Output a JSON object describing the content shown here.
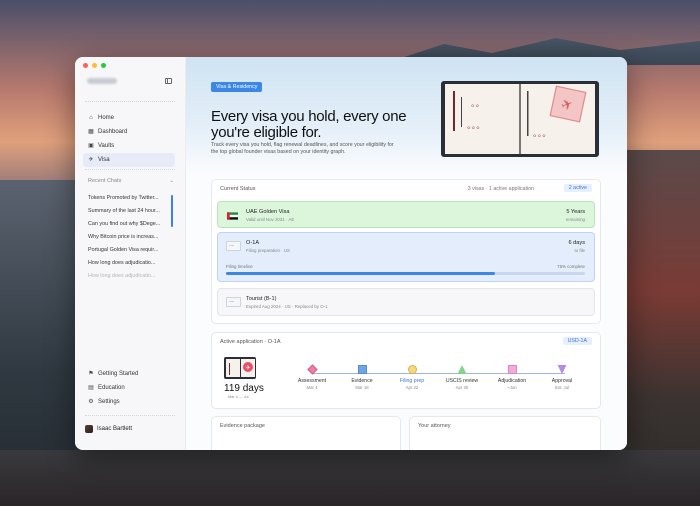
{
  "nav": {
    "home": "Home",
    "dashboard": "Dashboard",
    "vaults": "Vaults",
    "visa": "Visa"
  },
  "recent": {
    "heading": "Recent Chats",
    "items": [
      "Tokens Promoted by Twitter...",
      "Summary of the last 24 hour...",
      "Can you find out why $Dege...",
      "Why Bitcoin price is increas...",
      "Portugal Golden Visa requir...",
      "How long does adjudicatio...",
      "How long does adjudicatio..."
    ]
  },
  "bottom_nav": {
    "getting_started": "Getting Started",
    "education": "Education",
    "settings": "Settings"
  },
  "user": {
    "name": "Isaac Bartlett"
  },
  "hero": {
    "tag": "Visa & Residency",
    "title": "Every visa you hold, every one you're eligible for.",
    "subtitle": "Track every visa you hold, flag renewal deadlines, and score your eligibility for the top global founder visas based on your identity graph."
  },
  "current_status": {
    "heading": "Current Status",
    "summary": "3 visas · 1 active application",
    "badge": "2 active",
    "rows": [
      {
        "title": "UAE Golden Visa",
        "sub": "Valid until Nov 2031 · AE",
        "value": "5 Years",
        "value_sub": "remaining"
      },
      {
        "title": "O-1A",
        "sub": "Filing preparation · US",
        "value": "6 days",
        "value_sub": "to file",
        "progress_label": "Filing timeline",
        "progress_text": "75% complete",
        "progress": 0.75
      },
      {
        "title": "Tourist (B-1)",
        "sub": "Expired Aug 2024 · US · Replaced by O-1"
      }
    ]
  },
  "active_application": {
    "heading": "Active application · O-1A",
    "badge": "USD-1A",
    "days": "119 days",
    "days_sub": "Mar 4 → Jul",
    "steps": [
      {
        "label": "Assessment",
        "date": "Mar 4",
        "color": "#f07aa8",
        "shape": "diamond"
      },
      {
        "label": "Evidence",
        "date": "Mar 18",
        "color": "#6aa6ea",
        "shape": "square"
      },
      {
        "label": "Filing prep",
        "date": "Apr 22",
        "color": "#f5d97a",
        "shape": "circle"
      },
      {
        "label": "USCIS review",
        "date": "Apr 30",
        "color": "#7fd38a",
        "shape": "triangle"
      },
      {
        "label": "Adjudication",
        "date": "~Jun",
        "color": "#f5a8e0",
        "shape": "square"
      },
      {
        "label": "Approval",
        "date": "Est. Jul",
        "color": "#b48be8",
        "shape": "tri-down"
      }
    ]
  },
  "evidence": {
    "heading": "Evidence package"
  },
  "attorney": {
    "heading": "Your attorney"
  }
}
